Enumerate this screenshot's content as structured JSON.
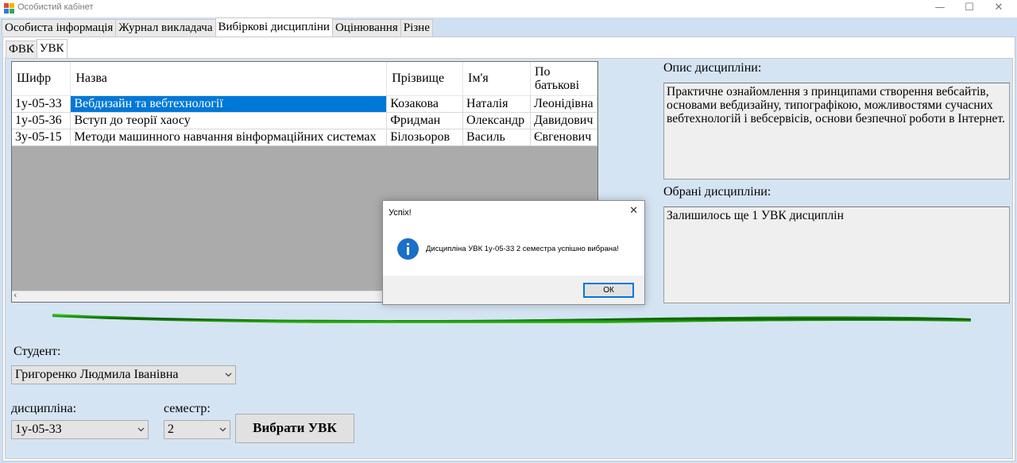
{
  "window": {
    "title": "Особистий кабінет",
    "minimize": "—",
    "maximize": "☐",
    "close": "✕"
  },
  "tabs_top": [
    "Особиста інформація",
    "Журнал викладача",
    "Вибіркові дисципліни",
    "Оцінювання",
    "Різне"
  ],
  "tabs_inner": [
    "ФВК",
    "УВК"
  ],
  "grid": {
    "columns": [
      "Шифр",
      "Назва",
      "Прізвище",
      "Ім'я",
      "По батькові"
    ],
    "rows": [
      [
        "1у-05-33",
        "Вебдизайн та вебтехнології",
        "Козакова",
        "Наталія",
        "Леонідівна"
      ],
      [
        "1у-05-36",
        "Вступ до теорії хаосу",
        "Фридман",
        "Олександр",
        "Давидович"
      ],
      [
        "3у-05-15",
        "Методи машинного навчання вінформаційних системах",
        "Білозьоров",
        "Василь",
        "Євгенович"
      ]
    ]
  },
  "description": {
    "label": "Опис дисципліни:",
    "text": "Практичне ознайомлення з принципами створення вебсайтів, основами вебдизайну, типографікою, можливостями сучасних вебтехнологій і вебсервісів, основи безпечної роботи в Інтернет."
  },
  "selected": {
    "label": "Обрані дисципліни:",
    "text": "Залишилось ще 1 УВК дисциплін"
  },
  "student": {
    "label": "Студент:",
    "value": "Григоренко Людмила Іванівна"
  },
  "discipline": {
    "label": "дисципліна:",
    "value": "1у-05-33"
  },
  "semester": {
    "label": "семестр:",
    "value": "2"
  },
  "select_button": {
    "bold": "Вибрати УВК",
    "rest": ""
  },
  "dialog": {
    "title": "Успіх!",
    "message": "Дисципліна УВК 1у-05-33 2 семестра успішно вибрана!",
    "ok": "ОК"
  },
  "colors": {
    "selection": "#0078d7",
    "background": "#d5e4f3",
    "green_stroke": "#2fd51a",
    "info_icon": "#1a6fc9"
  }
}
